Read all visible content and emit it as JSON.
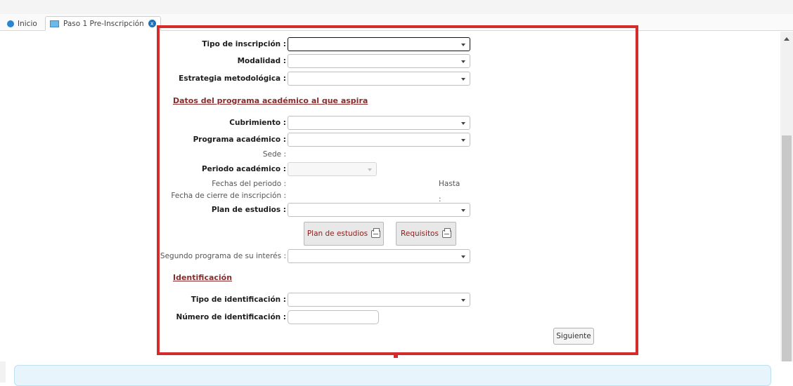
{
  "tabs": {
    "home_label": "Inicio",
    "active_label": "Paso 1 Pre-Inscripción",
    "close_symbol": "x"
  },
  "form": {
    "tipo_inscripcion": {
      "label": "Tipo de inscripción :",
      "value": ""
    },
    "modalidad": {
      "label": "Modalidad :",
      "value": ""
    },
    "estrategia": {
      "label": "Estrategia metodológica :",
      "value": ""
    },
    "section_programa": "Datos del programa académico al que aspira",
    "cubrimiento": {
      "label": "Cubrimiento :",
      "value": ""
    },
    "programa": {
      "label": "Programa académico :",
      "value": ""
    },
    "sede": {
      "label": "Sede :",
      "value": ""
    },
    "periodo": {
      "label": "Periodo académico :",
      "value": ""
    },
    "fechas_periodo": {
      "label": "Fechas del periodo :",
      "hasta_label": "Hasta :"
    },
    "fecha_cierre": {
      "label": "Fecha de cierre de inscripción :"
    },
    "plan_estudios": {
      "label": "Plan de estudios :",
      "value": ""
    },
    "buttons": {
      "plan": "Plan de estudios",
      "requisitos": "Requisitos"
    },
    "segundo_programa": {
      "label": "Segundo programa de su interés :",
      "value": ""
    },
    "section_identificacion": "Identificación",
    "tipo_identificacion": {
      "label": "Tipo de identificación :",
      "value": ""
    },
    "numero_identificacion": {
      "label": "Número de identificación :",
      "value": ""
    },
    "siguiente": "Siguiente"
  },
  "colors": {
    "highlight_frame": "#d42b2b",
    "section_title": "#8a2b2b",
    "info_bar": "#e7f4fb",
    "tab_icon": "#2b86d1"
  }
}
